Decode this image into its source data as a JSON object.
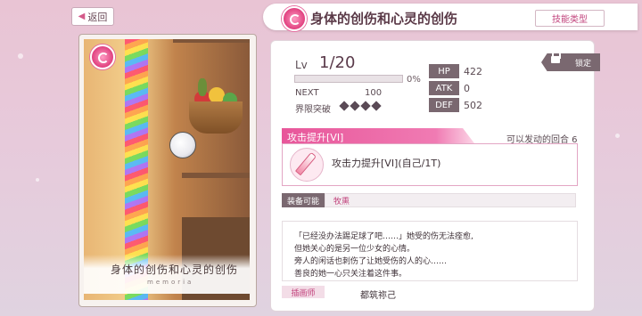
{
  "nav": {
    "back_label": "返回",
    "title": "身体的创伤和心灵的创伤",
    "skill_type_label": "技能类型"
  },
  "card": {
    "title": "身体的创伤和心灵的创伤",
    "subtitle": "memoria"
  },
  "level": {
    "lv_label": "Lv",
    "value": "1/20",
    "exp_percent_text": "0%",
    "exp_fraction": 0.0,
    "next_label": "NEXT",
    "next_value": "100",
    "limit_break_label": "界限突破",
    "limit_break_filled": 0,
    "limit_break_total": 4
  },
  "stats": [
    {
      "label": "HP",
      "value": "422"
    },
    {
      "label": "ATK",
      "value": "0"
    },
    {
      "label": "DEF",
      "value": "502"
    }
  ],
  "lock_label": "锁定",
  "skill": {
    "name": "攻击提升[VI]",
    "turn_label": "可以发动的回合 6",
    "description": "攻击力提升[VI](自己/1T)",
    "icon": "sword-icon"
  },
  "equip": {
    "label": "装备可能",
    "value": "牧熏"
  },
  "flavor_text": [
    "「已经没办法踢足球了吧……」她受的伤无法痊愈,",
    "但她关心的是另一位少女的心情。",
    "旁人的闲话也刺伤了让她受伤的人的心……",
    "善良的她一心只关注着这件事。"
  ],
  "illustrator": {
    "label": "插画师",
    "name": "都筑祢己"
  },
  "colors": {
    "accent": "#e8569a",
    "tag_bg": "#7a6870"
  }
}
